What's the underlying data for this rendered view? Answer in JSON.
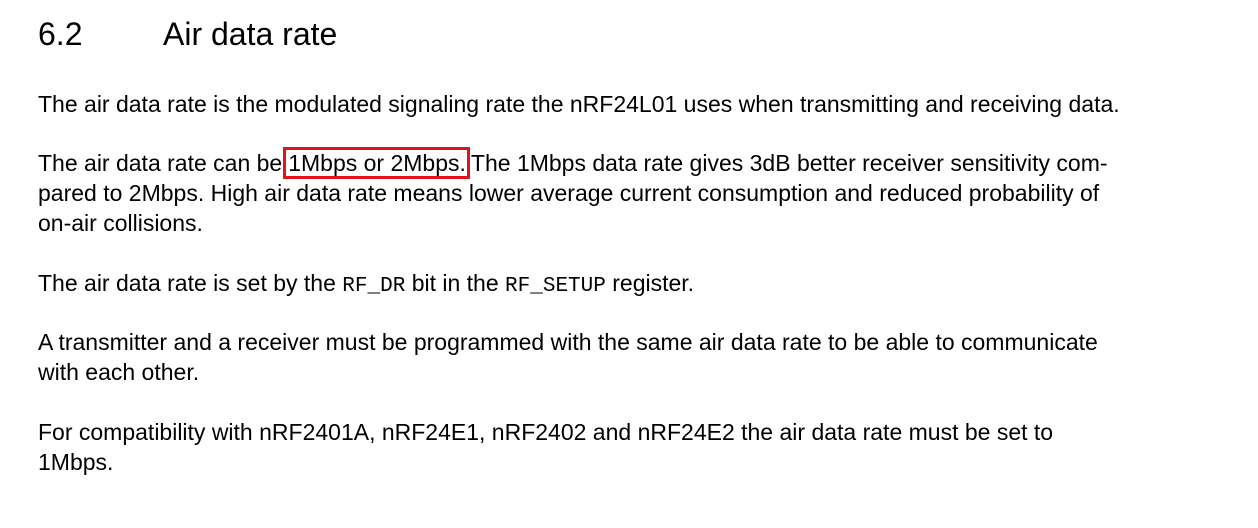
{
  "section": {
    "number": "6.2",
    "title": "Air data rate"
  },
  "paragraphs": {
    "p1": "The air data rate is the modulated signaling rate the nRF24L01 uses when transmitting and receiving data.",
    "p2": {
      "before": "The air data rate can be",
      "highlighted": "1Mbps or 2Mbps.",
      "after_line1": "The 1Mbps data rate gives 3dB better receiver sensitivity com-",
      "line2": "pared to 2Mbps. High air data rate means lower average current consumption and reduced probability of",
      "line3": "on-air collisions."
    },
    "p3": {
      "part1": "The air data rate is set by the",
      "code1": "RF_DR",
      "part2": "bit in the",
      "code2": "RF_SETUP",
      "part3": "register."
    },
    "p4": {
      "line1": "A transmitter and a receiver must be programmed with the same air data rate to be able to communicate",
      "line2": "with each other."
    },
    "p5": {
      "line1": "For compatibility with nRF2401A, nRF24E1, nRF2402 and nRF24E2 the air data rate must be set to",
      "line2": "1Mbps."
    }
  },
  "colors": {
    "highlight_border": "#e8101a"
  }
}
